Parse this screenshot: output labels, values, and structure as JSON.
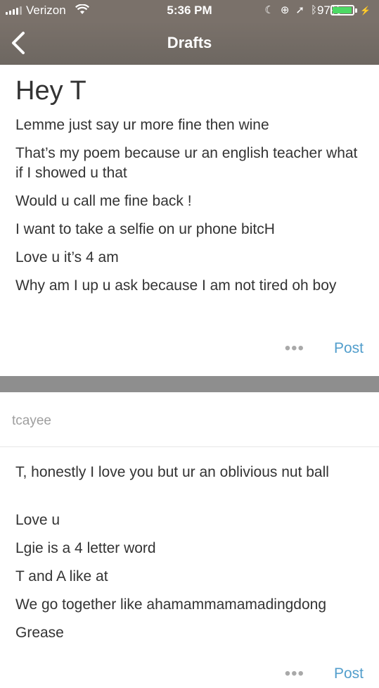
{
  "status_bar": {
    "carrier": "Verizon",
    "time": "5:36 PM",
    "battery_percent": "97%",
    "battery_level": 0.97,
    "icons": [
      "signal-bars-icon",
      "wifi-icon",
      "moon-icon",
      "rotation-lock-icon",
      "location-arrow-icon",
      "bluetooth-icon",
      "battery-icon",
      "charging-bolt-icon"
    ],
    "battery_color": "#4cd964"
  },
  "nav": {
    "title": "Drafts",
    "back_icon": "chevron-left-icon"
  },
  "drafts": [
    {
      "title": "Hey T",
      "paragraphs": [
        "Lemme just say ur more fine then wine",
        "That’s my poem because ur an english teacher what if I showed u that",
        "Would u call me fine back !",
        "I want to take a selfie on ur phone bitcH",
        "Love u it’s 4 am",
        "Why am I up u ask because I am not tired oh boy"
      ],
      "more_label": "•••",
      "post_label": "Post"
    },
    {
      "username": "tcayee",
      "paragraphs": [
        "T, honestly I love you but ur an oblivious nut ball",
        "Love u",
        "Lgie is a 4 letter word",
        "T and A like at",
        "We go together like ahamammamamadingdong",
        "Grease"
      ],
      "more_label": "•••",
      "post_label": "Post"
    }
  ],
  "colors": {
    "accent": "#529ecc",
    "background": "#8e8e8e",
    "card": "#ffffff",
    "text": "#333333",
    "muted": "#9e9e9e"
  }
}
